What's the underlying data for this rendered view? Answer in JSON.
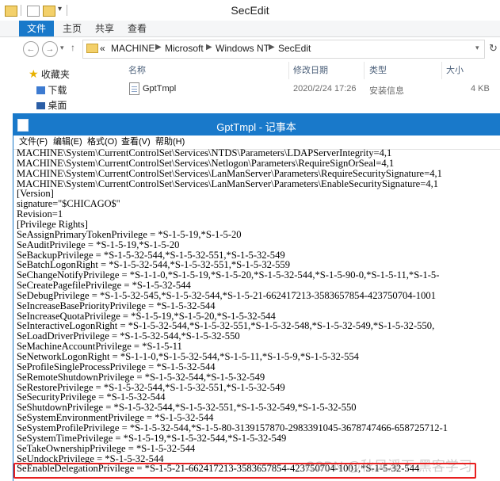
{
  "explorer": {
    "title": "SecEdit",
    "tabs": [
      "文件",
      "主页",
      "共享",
      "查看"
    ],
    "breadcrumbs": [
      "MACHINE",
      "Microsoft",
      "Windows NT",
      "SecEdit"
    ],
    "breadcrumb_prefix": "«",
    "sidebar": [
      "收藏夹",
      "下载",
      "桌面"
    ],
    "columns": {
      "name": "名称",
      "modified": "修改日期",
      "type": "类型",
      "size": "大小"
    },
    "file": {
      "name": "GptTmpl",
      "modified": "2020/2/24 17:26",
      "type": "安装信息",
      "size": "4 KB"
    }
  },
  "notepad": {
    "title": "GptTmpl - 记事本",
    "menu": [
      "文件(F)",
      "编辑(E)",
      "格式(O)",
      "查看(V)",
      "帮助(H)"
    ],
    "lines": [
      "MACHINE\\System\\CurrentControlSet\\Services\\NTDS\\Parameters\\LDAPServerIntegrity=4,1",
      "MACHINE\\System\\CurrentControlSet\\Services\\Netlogon\\Parameters\\RequireSignOrSeal=4,1",
      "MACHINE\\System\\CurrentControlSet\\Services\\LanManServer\\Parameters\\RequireSecuritySignature=4,1",
      "MACHINE\\System\\CurrentControlSet\\Services\\LanManServer\\Parameters\\EnableSecuritySignature=4,1",
      "[Version]",
      "signature=\"$CHICAGO$\"",
      "Revision=1",
      "[Privilege Rights]",
      "SeAssignPrimaryTokenPrivilege = *S-1-5-19,*S-1-5-20",
      "SeAuditPrivilege = *S-1-5-19,*S-1-5-20",
      "SeBackupPrivilege = *S-1-5-32-544,*S-1-5-32-551,*S-1-5-32-549",
      "SeBatchLogonRight = *S-1-5-32-544,*S-1-5-32-551,*S-1-5-32-559",
      "SeChangeNotifyPrivilege = *S-1-1-0,*S-1-5-19,*S-1-5-20,*S-1-5-32-544,*S-1-5-90-0,*S-1-5-11,*S-1-5-",
      "SeCreatePagefilePrivilege = *S-1-5-32-544",
      "SeDebugPrivilege = *S-1-5-32-545,*S-1-5-32-544,*S-1-5-21-662417213-3583657854-423750704-1001",
      "SeIncreaseBasePriorityPrivilege = *S-1-5-32-544",
      "SeIncreaseQuotaPrivilege = *S-1-5-19,*S-1-5-20,*S-1-5-32-544",
      "SeInteractiveLogonRight = *S-1-5-32-544,*S-1-5-32-551,*S-1-5-32-548,*S-1-5-32-549,*S-1-5-32-550,",
      "SeLoadDriverPrivilege = *S-1-5-32-544,*S-1-5-32-550",
      "SeMachineAccountPrivilege = *S-1-5-11",
      "SeNetworkLogonRight = *S-1-1-0,*S-1-5-32-544,*S-1-5-11,*S-1-5-9,*S-1-5-32-554",
      "SeProfileSingleProcessPrivilege = *S-1-5-32-544",
      "SeRemoteShutdownPrivilege = *S-1-5-32-544,*S-1-5-32-549",
      "SeRestorePrivilege = *S-1-5-32-544,*S-1-5-32-551,*S-1-5-32-549",
      "SeSecurityPrivilege = *S-1-5-32-544",
      "SeShutdownPrivilege = *S-1-5-32-544,*S-1-5-32-551,*S-1-5-32-549,*S-1-5-32-550",
      "SeSystemEnvironmentPrivilege = *S-1-5-32-544",
      "SeSystemProfilePrivilege = *S-1-5-32-544,*S-1-5-80-3139157870-2983391045-3678747466-658725712-1",
      "SeSystemTimePrivilege = *S-1-5-19,*S-1-5-32-544,*S-1-5-32-549",
      "SeTakeOwnershipPrivilege = *S-1-5-32-544",
      "SeUndockPrivilege = *S-1-5-32-544",
      "SeEnableDelegationPrivilege = *S-1-5-21-662417213-3583657854-423750704-1001,*S-1-5-32-544"
    ],
    "watermark": "CSDN @秋风溪下  黑客学习"
  },
  "colors": {
    "accent": "#1979ca",
    "highlight": "#e82020"
  }
}
